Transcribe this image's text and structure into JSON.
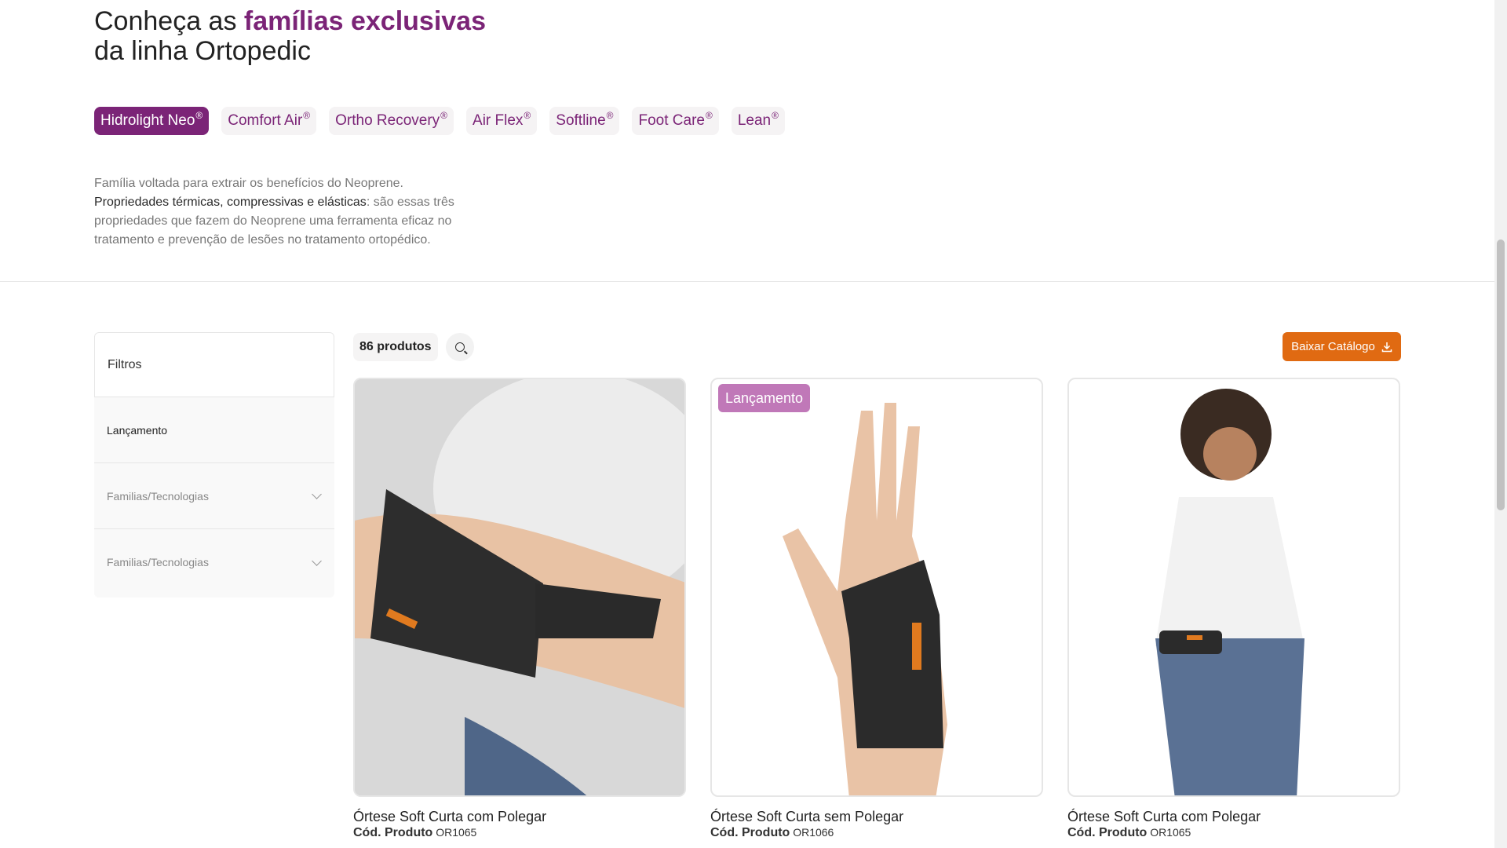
{
  "heading": {
    "line1_plain": "Conheça as ",
    "line1_highlight": "famílias exclusivas",
    "line2": "da linha Ortopedic"
  },
  "tabs": [
    {
      "label": "Hidrolight Neo",
      "reg": "®",
      "active": true
    },
    {
      "label": "Comfort Air",
      "reg": "®"
    },
    {
      "label": "Ortho Recovery",
      "reg": "®"
    },
    {
      "label": "Air Flex",
      "reg": "®"
    },
    {
      "label": "Softline",
      "reg": "®"
    },
    {
      "label": "Foot Care",
      "reg": "®"
    },
    {
      "label": "Lean",
      "reg": "®"
    }
  ],
  "description": {
    "line1": "Família voltada para extrair os benefícios do Neoprene.",
    "bold": "Propriedades térmicas, compressivas e elásticas",
    "rest": ": são essas três propriedades que fazem do Neoprene uma ferramenta eficaz no tratamento e prevenção de lesões no tratamento ortopédico."
  },
  "filters": {
    "title": "Filtros",
    "items": [
      "Lançamento",
      "Familias/Tecnologias",
      "Familias/Tecnologias"
    ]
  },
  "toolbar": {
    "count": "86 produtos",
    "download_label": "Baixar Catálogo"
  },
  "products": [
    {
      "name": "Órtese Soft Curta com Polegar",
      "code_label": "Cód. Produto",
      "code": "OR1065",
      "badge": ""
    },
    {
      "name": "Órtese Soft Curta sem Polegar",
      "code_label": "Cód. Produto",
      "code": "OR1066",
      "badge": "Lançamento"
    },
    {
      "name": "Órtese Soft Curta com Polegar",
      "code_label": "Cód. Produto",
      "code": "OR1065",
      "badge": ""
    }
  ],
  "colors": {
    "brand_purple": "#7b2477",
    "badge_pink": "#c078b8",
    "cta_orange": "#e06a12"
  }
}
